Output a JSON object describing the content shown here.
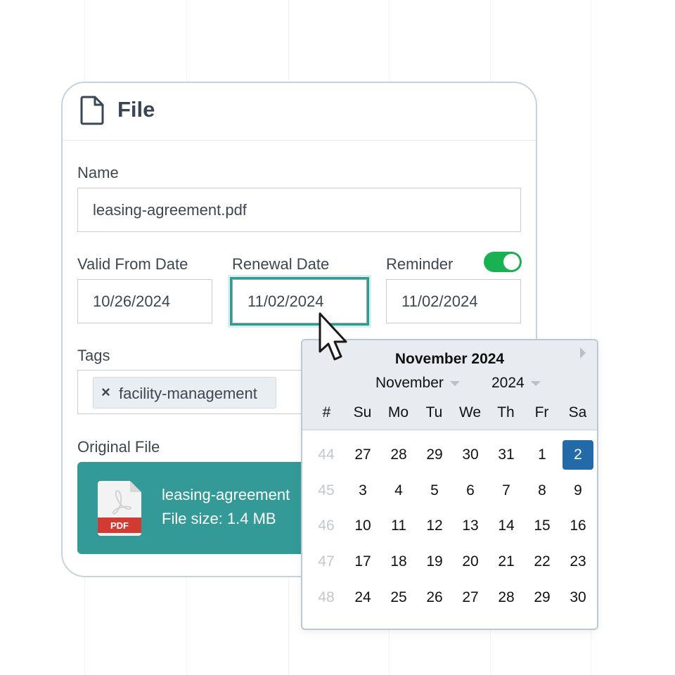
{
  "card": {
    "title": "File",
    "name_label": "Name",
    "name_value": "leasing-agreement.pdf",
    "valid_from_label": "Valid From Date",
    "valid_from_value": "10/26/2024",
    "renewal_label": "Renewal Date",
    "renewal_value": "11/02/2024",
    "reminder_label": "Reminder",
    "reminder_enabled": true,
    "reminder_value": "11/02/2024",
    "tags_label": "Tags",
    "tags": [
      {
        "remove": "×",
        "label": "facility-management"
      }
    ],
    "original_file_label": "Original File",
    "file": {
      "name": "leasing-agreement",
      "size": "File size: 1.4 MB",
      "badge": "PDF"
    }
  },
  "calendar": {
    "title": "November 2024",
    "month_select": "November",
    "year_select": "2024",
    "week_header": "#",
    "weekdays": [
      "Su",
      "Mo",
      "Tu",
      "We",
      "Th",
      "Fr",
      "Sa"
    ],
    "selected_day": "2",
    "weeks": [
      {
        "week": "44",
        "days": [
          "27",
          "28",
          "29",
          "30",
          "31",
          "1",
          "2"
        ]
      },
      {
        "week": "45",
        "days": [
          "3",
          "4",
          "5",
          "6",
          "7",
          "8",
          "9"
        ]
      },
      {
        "week": "46",
        "days": [
          "10",
          "11",
          "12",
          "13",
          "14",
          "15",
          "16"
        ]
      },
      {
        "week": "47",
        "days": [
          "17",
          "18",
          "19",
          "20",
          "21",
          "22",
          "23"
        ]
      },
      {
        "week": "48",
        "days": [
          "24",
          "25",
          "26",
          "27",
          "28",
          "29",
          "30"
        ]
      }
    ]
  },
  "colors": {
    "accent": "#339a98",
    "toggle_on": "#19b152",
    "selected_day": "#226aa8",
    "focus_ring": "#2a9d95"
  }
}
